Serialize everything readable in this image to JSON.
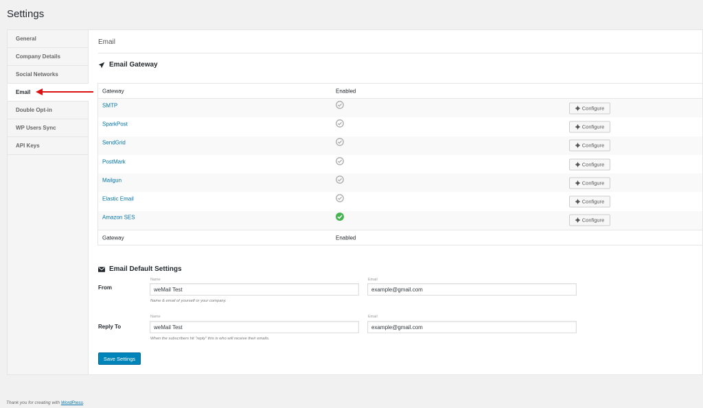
{
  "page_title": "Settings",
  "sidebar": {
    "items": [
      {
        "label": "General"
      },
      {
        "label": "Company Details"
      },
      {
        "label": "Social Networks"
      },
      {
        "label": "Email"
      },
      {
        "label": "Double Opt-in"
      },
      {
        "label": "WP Users Sync"
      },
      {
        "label": "API Keys"
      }
    ],
    "active": "Email"
  },
  "main": {
    "section_title": "Email",
    "gateway": {
      "heading": "Email Gateway",
      "col_gateway": "Gateway",
      "col_enabled": "Enabled",
      "configure_label": "Configure",
      "rows": [
        {
          "name": "SMTP",
          "enabled": false
        },
        {
          "name": "SparkPost",
          "enabled": false
        },
        {
          "name": "SendGrid",
          "enabled": false
        },
        {
          "name": "PostMark",
          "enabled": false
        },
        {
          "name": "Mailgun",
          "enabled": false
        },
        {
          "name": "Elastic Email",
          "enabled": false
        },
        {
          "name": "Amazon SES",
          "enabled": true
        }
      ]
    },
    "defaults": {
      "heading": "Email Default Settings",
      "from": {
        "label": "From",
        "name_label": "Name",
        "name_value": "weMail Test",
        "email_label": "Email",
        "email_value": "example@gmail.com",
        "help": "Name & email of yourself or your company."
      },
      "reply_to": {
        "label": "Reply To",
        "name_label": "Name",
        "name_value": "weMail Test",
        "email_label": "Email",
        "email_value": "example@gmail.com",
        "help": "When the subscribers hit \"reply\" this is who will receive their emails."
      },
      "save_label": "Save Settings"
    }
  },
  "footer": {
    "text": "Thank you for creating with ",
    "link": "WordPress",
    "suffix": "."
  },
  "colors": {
    "accent": "#0073aa",
    "button": "#0085ba",
    "enabled": "#46b450",
    "disabled": "#aaaaaa",
    "arrow": "#dd1111"
  }
}
